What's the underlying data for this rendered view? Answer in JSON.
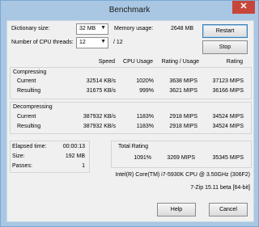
{
  "window": {
    "title": "Benchmark",
    "close_glyph": "✕"
  },
  "settings": {
    "dictionary_label": "Dictionary size:",
    "dictionary_value": "32 MB",
    "memory_label": "Memory usage:",
    "memory_value": "2648 MB",
    "threads_label": "Number of CPU threads:",
    "threads_value": "12",
    "threads_max": "/ 12"
  },
  "buttons": {
    "restart": "Restart",
    "stop": "Stop",
    "help": "Help",
    "cancel": "Cancel"
  },
  "columns": {
    "speed": "Speed",
    "cpu_usage": "CPU Usage",
    "rating_usage": "Rating / Usage",
    "rating": "Rating"
  },
  "compressing": {
    "title": "Compressing",
    "rows": [
      {
        "label": "Current",
        "speed": "32514 KB/s",
        "cpu": "1020%",
        "ru": "3638 MIPS",
        "rating": "37123 MIPS"
      },
      {
        "label": "Resulting",
        "speed": "31675 KB/s",
        "cpu": "999%",
        "ru": "3621 MIPS",
        "rating": "36166 MIPS"
      }
    ]
  },
  "decompressing": {
    "title": "Decompressing",
    "rows": [
      {
        "label": "Current",
        "speed": "387932 KB/s",
        "cpu": "1183%",
        "ru": "2918 MIPS",
        "rating": "34524 MIPS"
      },
      {
        "label": "Resulting",
        "speed": "387932 KB/s",
        "cpu": "1183%",
        "ru": "2918 MIPS",
        "rating": "34524 MIPS"
      }
    ]
  },
  "stats": {
    "elapsed_label": "Elapsed time:",
    "elapsed_value": "00:00:13",
    "size_label": "Size:",
    "size_value": "192 MB",
    "passes_label": "Passes:",
    "passes_value": "1"
  },
  "total": {
    "title": "Total Rating",
    "cpu": "1091%",
    "ru": "3269 MIPS",
    "rating": "35345 MIPS"
  },
  "cpu_info": "Intel(R) Core(TM) i7-5930K CPU @ 3.50GHz (306F2)",
  "version": "7-Zip 15.11 beta [64-bit]"
}
